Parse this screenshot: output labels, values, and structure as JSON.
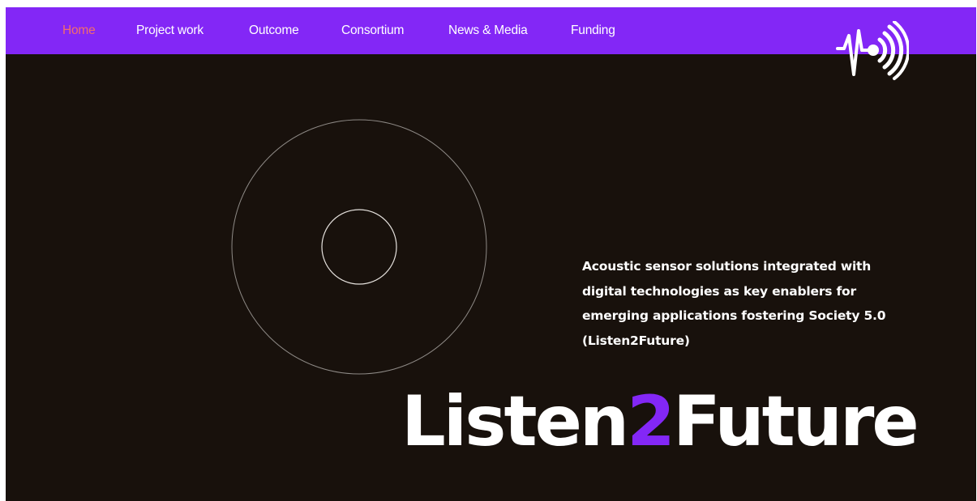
{
  "nav": {
    "items": [
      {
        "label": "Home",
        "active": true
      },
      {
        "label": "Project work"
      },
      {
        "label": "Outcome"
      },
      {
        "label": "Consortium"
      },
      {
        "label": "News & Media"
      },
      {
        "label": "Funding"
      }
    ]
  },
  "logo": {
    "icon": "sound-wave-pulse-icon"
  },
  "hero": {
    "tagline_lines": [
      "Acoustic sensor solutions integrated with",
      "digital technologies as key enablers for",
      "emerging applications fostering Society 5.0",
      "(Listen2Future)"
    ],
    "wordmark": {
      "part1": "Listen",
      "part2": "2",
      "part3": "Future"
    }
  },
  "colors": {
    "nav_background": "#8327f6",
    "page_background": "#18110c",
    "active_nav": "#f26d6d",
    "accent": "#8327f6",
    "text": "#ffffff"
  }
}
